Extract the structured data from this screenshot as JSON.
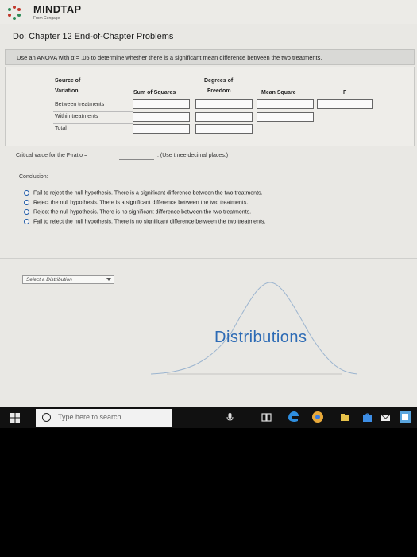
{
  "header": {
    "brand": "MINDTAP",
    "brand_sub": "From Cengage"
  },
  "page": {
    "title": "Do: Chapter 12 End-of-Chapter Problems",
    "instruction": "Use an ANOVA with α = .05 to determine whether there is a significant mean difference between the two treatments."
  },
  "anova_table": {
    "headers": {
      "source_line1": "Source of",
      "source_line2": "Variation",
      "ss": "Sum of Squares",
      "df_line1": "Degrees of",
      "df_line2": "Freedom",
      "ms": "Mean Square",
      "f": "F"
    },
    "rows": [
      "Between treatments",
      "Within treatments",
      "Total"
    ]
  },
  "critical": {
    "label": "Critical value for the F-ratio =",
    "note": ". (Use three decimal places.)"
  },
  "conclusion": {
    "label": "Conclusion:",
    "options": [
      "Fail to reject the null hypothesis. There is a significant difference between the two treatments.",
      "Reject the null hypothesis. There is a significant difference between the two treatments.",
      "Reject the null hypothesis. There is no significant difference between the two treatments.",
      "Fail to reject the null hypothesis. There is no significant difference between the two treatments."
    ]
  },
  "distribution": {
    "select_placeholder": "Select a Distribution",
    "label": "Distributions"
  },
  "taskbar": {
    "search_placeholder": "Type here to search"
  },
  "colors": {
    "accent": "#2d6bb5",
    "radio": "#1e5aa8",
    "taskbar": "#111111"
  }
}
